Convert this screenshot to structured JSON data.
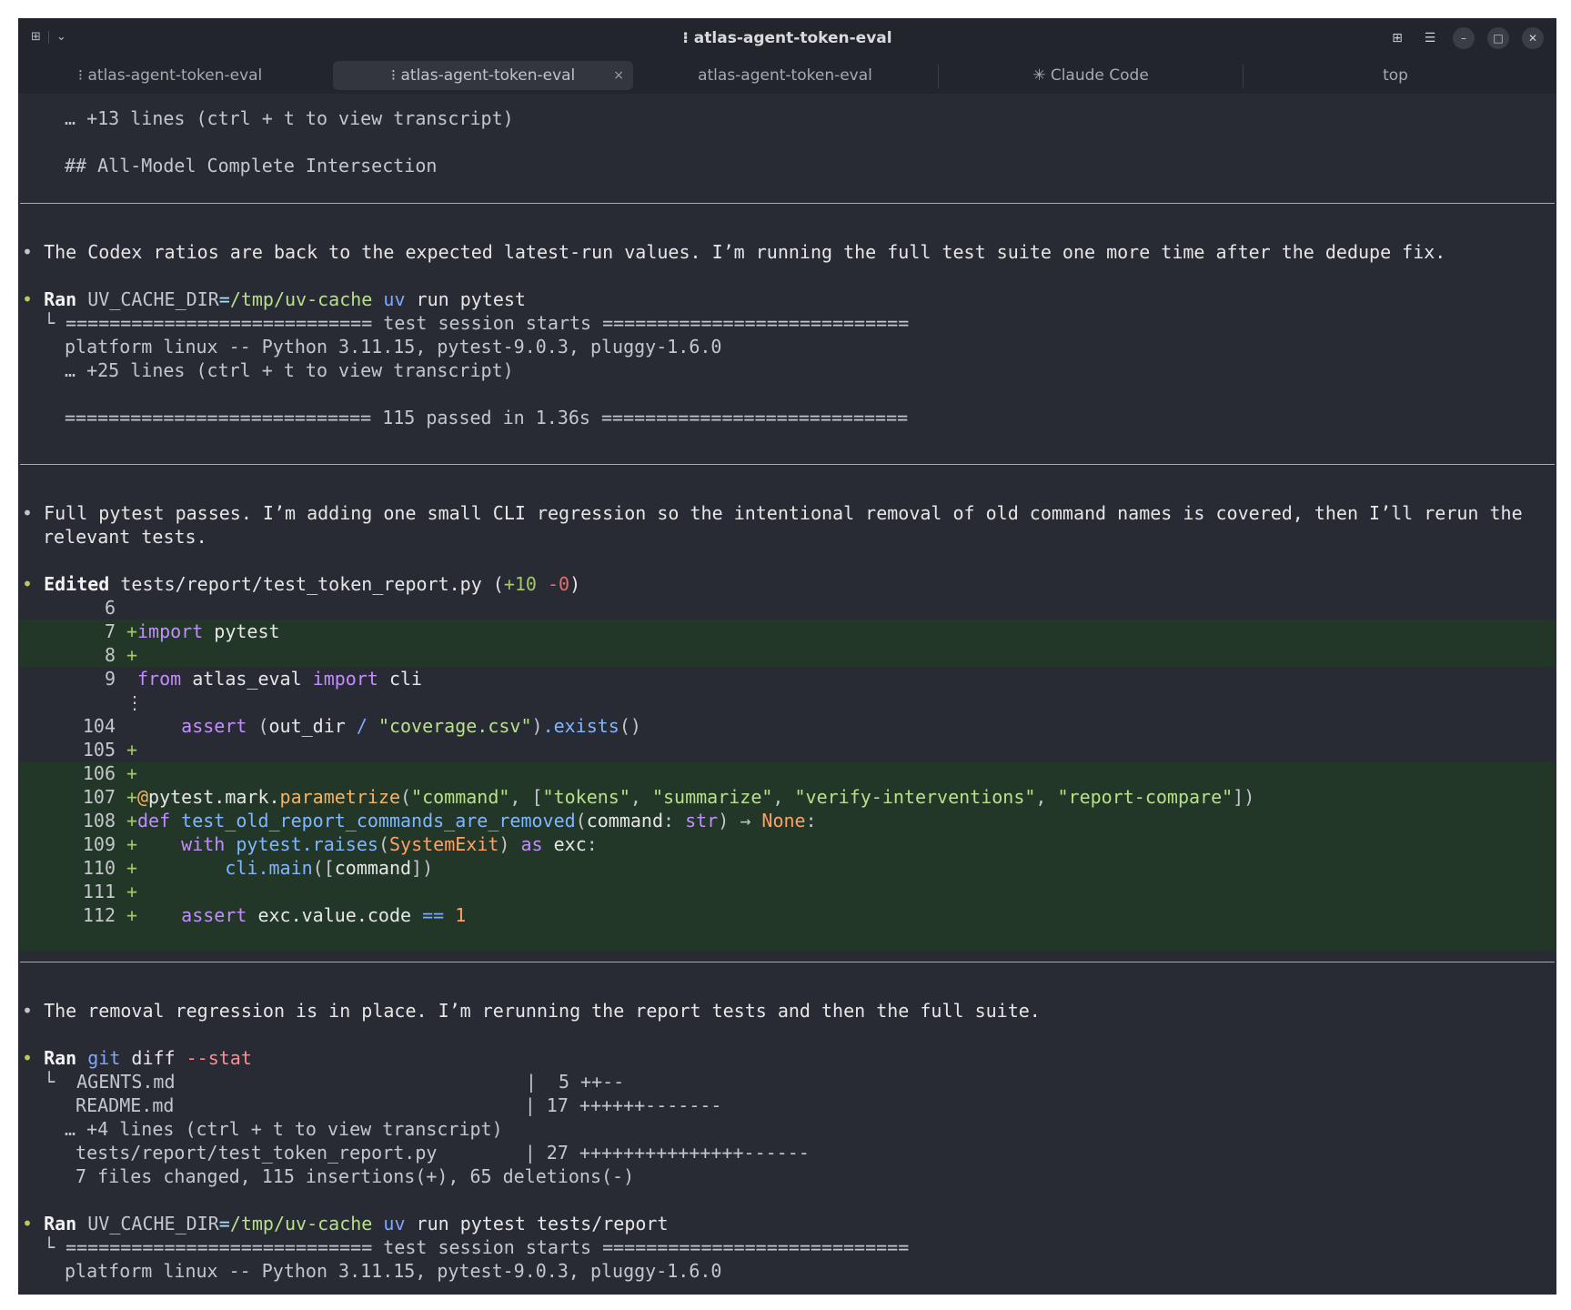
{
  "window": {
    "title": "atlas-agent-token-eval",
    "title_icon": "drag-dots-icon"
  },
  "titlebar_controls": {
    "grid_icon": "⊞",
    "menu_icon": "☰",
    "minimize": "–",
    "maximize": "□",
    "close": "✕"
  },
  "tabs": [
    {
      "label": "⁝ atlas-agent-token-eval"
    },
    {
      "label": "⁝ atlas-agent-token-eval",
      "close": "×"
    },
    {
      "label": "atlas-agent-token-eval"
    },
    {
      "label": "✳ Claude Code"
    },
    {
      "label": "top"
    }
  ],
  "term": {
    "b1": {
      "more": "… +13 lines (ctrl + t to view transcript)",
      "heading": "## All-Model Complete Intersection"
    },
    "b2": {
      "message": "The Codex ratios are back to the expected latest-run values. I’m running the full test suite one more time after the dedupe fix."
    },
    "b3": {
      "ran": "Ran",
      "env": "UV_CACHE_DIR",
      "eq": "=",
      "path": "/tmp/uv-cache",
      "tool": "uv",
      "rest": " run pytest",
      "out1": "============================ test session starts ============================",
      "out2": "platform linux -- Python 3.11.15, pytest-9.0.3, pluggy-1.6.0",
      "out3": "… +25 lines (ctrl + t to view transcript)",
      "out4": "============================ 115 passed in 1.36s ============================"
    },
    "b4": {
      "message1": "Full pytest passes. I’m adding one small CLI regression so the intentional removal of old command names is covered, then I’ll rerun the",
      "message2": "relevant tests."
    },
    "b5": {
      "edited": "Edited",
      "file": "tests/report/test_token_report.py",
      "paren_open": " (",
      "plus": "+10",
      "minus": "-0",
      "paren_close": ")",
      "lines": [
        {
          "no": "6",
          "sign": " ",
          "code": ""
        },
        {
          "no": "7",
          "sign": "+",
          "code": "import pytest"
        },
        {
          "no": "8",
          "sign": "+",
          "code": ""
        },
        {
          "no": "9",
          "sign": " ",
          "code": "from atlas_eval import cli"
        },
        {
          "no": "⋮",
          "sign": "",
          "code": ""
        },
        {
          "no": "104",
          "sign": " ",
          "code": "    assert (out_dir / \"coverage.csv\").exists()"
        },
        {
          "no": "105",
          "sign": "+",
          "code": ""
        },
        {
          "no": "106",
          "sign": "+",
          "code": ""
        },
        {
          "no": "107",
          "sign": "+",
          "code": "@pytest.mark.parametrize(\"command\", [\"tokens\", \"summarize\", \"verify-interventions\", \"report-compare\"])"
        },
        {
          "no": "108",
          "sign": "+",
          "code": "def test_old_report_commands_are_removed(command: str) → None:"
        },
        {
          "no": "109",
          "sign": "+",
          "code": "    with pytest.raises(SystemExit) as exc:"
        },
        {
          "no": "110",
          "sign": "+",
          "code": "        cli.main([command])"
        },
        {
          "no": "111",
          "sign": "+",
          "code": ""
        },
        {
          "no": "112",
          "sign": "+",
          "code": "    assert exc.value.code == 1"
        }
      ]
    },
    "b6": {
      "message": "The removal regression is in place. I’m rerunning the report tests and then the full suite."
    },
    "b7": {
      "ran": "Ran",
      "tool": "git",
      "rest": " diff ",
      "flag": "--stat",
      "rows": [
        " AGENTS.md                                |  5 ++--",
        " README.md                                | 17 ++++++-------",
        "… +4 lines (ctrl + t to view transcript)",
        " tests/report/test_token_report.py        | 27 +++++++++++++++------",
        " 7 files changed, 115 insertions(+), 65 deletions(-)"
      ]
    },
    "b8": {
      "ran": "Ran",
      "env": "UV_CACHE_DIR",
      "eq": "=",
      "path": "/tmp/uv-cache",
      "tool": "uv",
      "rest": " run pytest tests/report",
      "out1": "============================ test session starts ============================",
      "out2": "platform linux -- Python 3.11.15, pytest-9.0.3, pluggy-1.6.0"
    }
  }
}
